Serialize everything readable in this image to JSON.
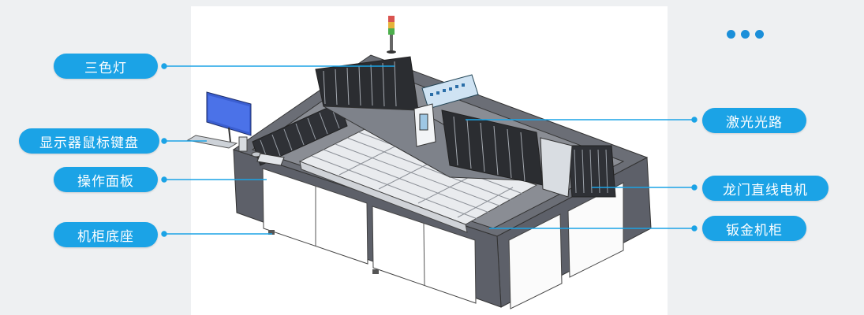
{
  "labels": {
    "tri_color_light": "三色灯",
    "monitor_mouse_keyboard": "显示器鼠标键盘",
    "control_panel": "操作面板",
    "cabinet_base": "机柜底座",
    "laser_path": "激光光路",
    "gantry_linear_motor": "龙门直线电机",
    "sheet_metal_cabinet": "钣金机柜"
  },
  "colors": {
    "accent": "#1ba3e6",
    "dots": "#1b8fd9",
    "machine_frame": "#5d6069",
    "background": "#eef0f2"
  },
  "icons": [
    "more-dots-icon"
  ]
}
